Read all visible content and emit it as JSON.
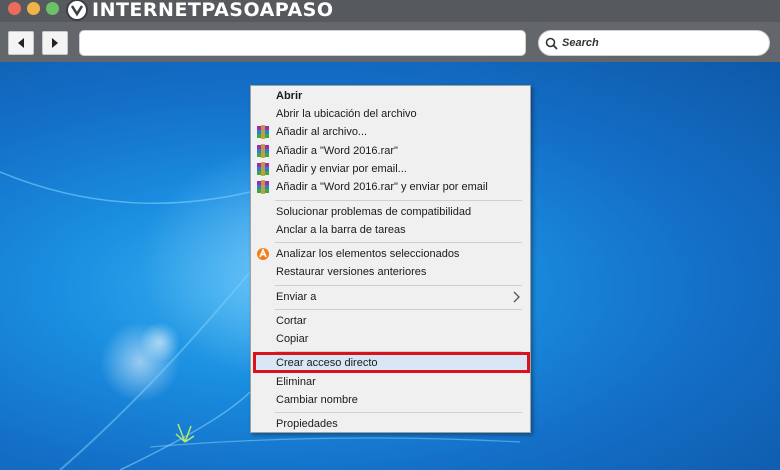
{
  "browser": {
    "logo_text": "INTERNETPASOAPASO",
    "search_placeholder": "Search"
  },
  "context_menu": {
    "groups": [
      [
        {
          "label": "Abrir",
          "bold": true,
          "icon": ""
        },
        {
          "label": "Abrir la ubicación del archivo",
          "icon": ""
        },
        {
          "label": "Añadir al archivo...",
          "icon": "winrar-icon"
        },
        {
          "label": "Añadir a \"Word 2016.rar\"",
          "icon": "winrar-icon"
        },
        {
          "label": "Añadir y enviar por email...",
          "icon": "winrar-icon"
        },
        {
          "label": "Añadir a \"Word 2016.rar\" y enviar por email",
          "icon": "winrar-icon"
        }
      ],
      [
        {
          "label": "Solucionar problemas de compatibilidad",
          "icon": ""
        },
        {
          "label": "Anclar a la barra de tareas",
          "icon": ""
        }
      ],
      [
        {
          "label": "Analizar los elementos seleccionados",
          "icon": "avast-icon"
        },
        {
          "label": "Restaurar versiones anteriores",
          "icon": ""
        }
      ],
      [
        {
          "label": "Enviar a",
          "icon": "",
          "submenu": true
        }
      ],
      [
        {
          "label": "Cortar",
          "icon": ""
        },
        {
          "label": "Copiar",
          "icon": ""
        }
      ],
      [
        {
          "label": "Crear acceso directo",
          "icon": "",
          "highlighted": true
        },
        {
          "label": "Eliminar",
          "icon": ""
        },
        {
          "label": "Cambiar nombre",
          "icon": ""
        }
      ],
      [
        {
          "label": "Propiedades",
          "icon": ""
        }
      ]
    ],
    "items_flat": {
      "abrir": "Abrir",
      "abrir_ubicacion": "Abrir la ubicación del archivo",
      "anadir_archivo": "Añadir al archivo...",
      "anadir_rar": "Añadir a \"Word 2016.rar\"",
      "anadir_enviar": "Añadir y enviar por email...",
      "anadir_rar_enviar": "Añadir a \"Word 2016.rar\" y enviar por email",
      "solucionar": "Solucionar problemas de compatibilidad",
      "anclar": "Anclar a la barra de tareas",
      "analizar": "Analizar los elementos seleccionados",
      "restaurar": "Restaurar versiones anteriores",
      "enviar_a": "Enviar a",
      "cortar": "Cortar",
      "copiar": "Copiar",
      "crear_acceso": "Crear acceso directo",
      "eliminar": "Eliminar",
      "cambiar_nombre": "Cambiar nombre",
      "propiedades": "Propiedades"
    }
  },
  "colors": {
    "highlight_border": "#d8131c",
    "desktop_blue": "#1a8ee0",
    "chrome_gray": "#63676c"
  }
}
